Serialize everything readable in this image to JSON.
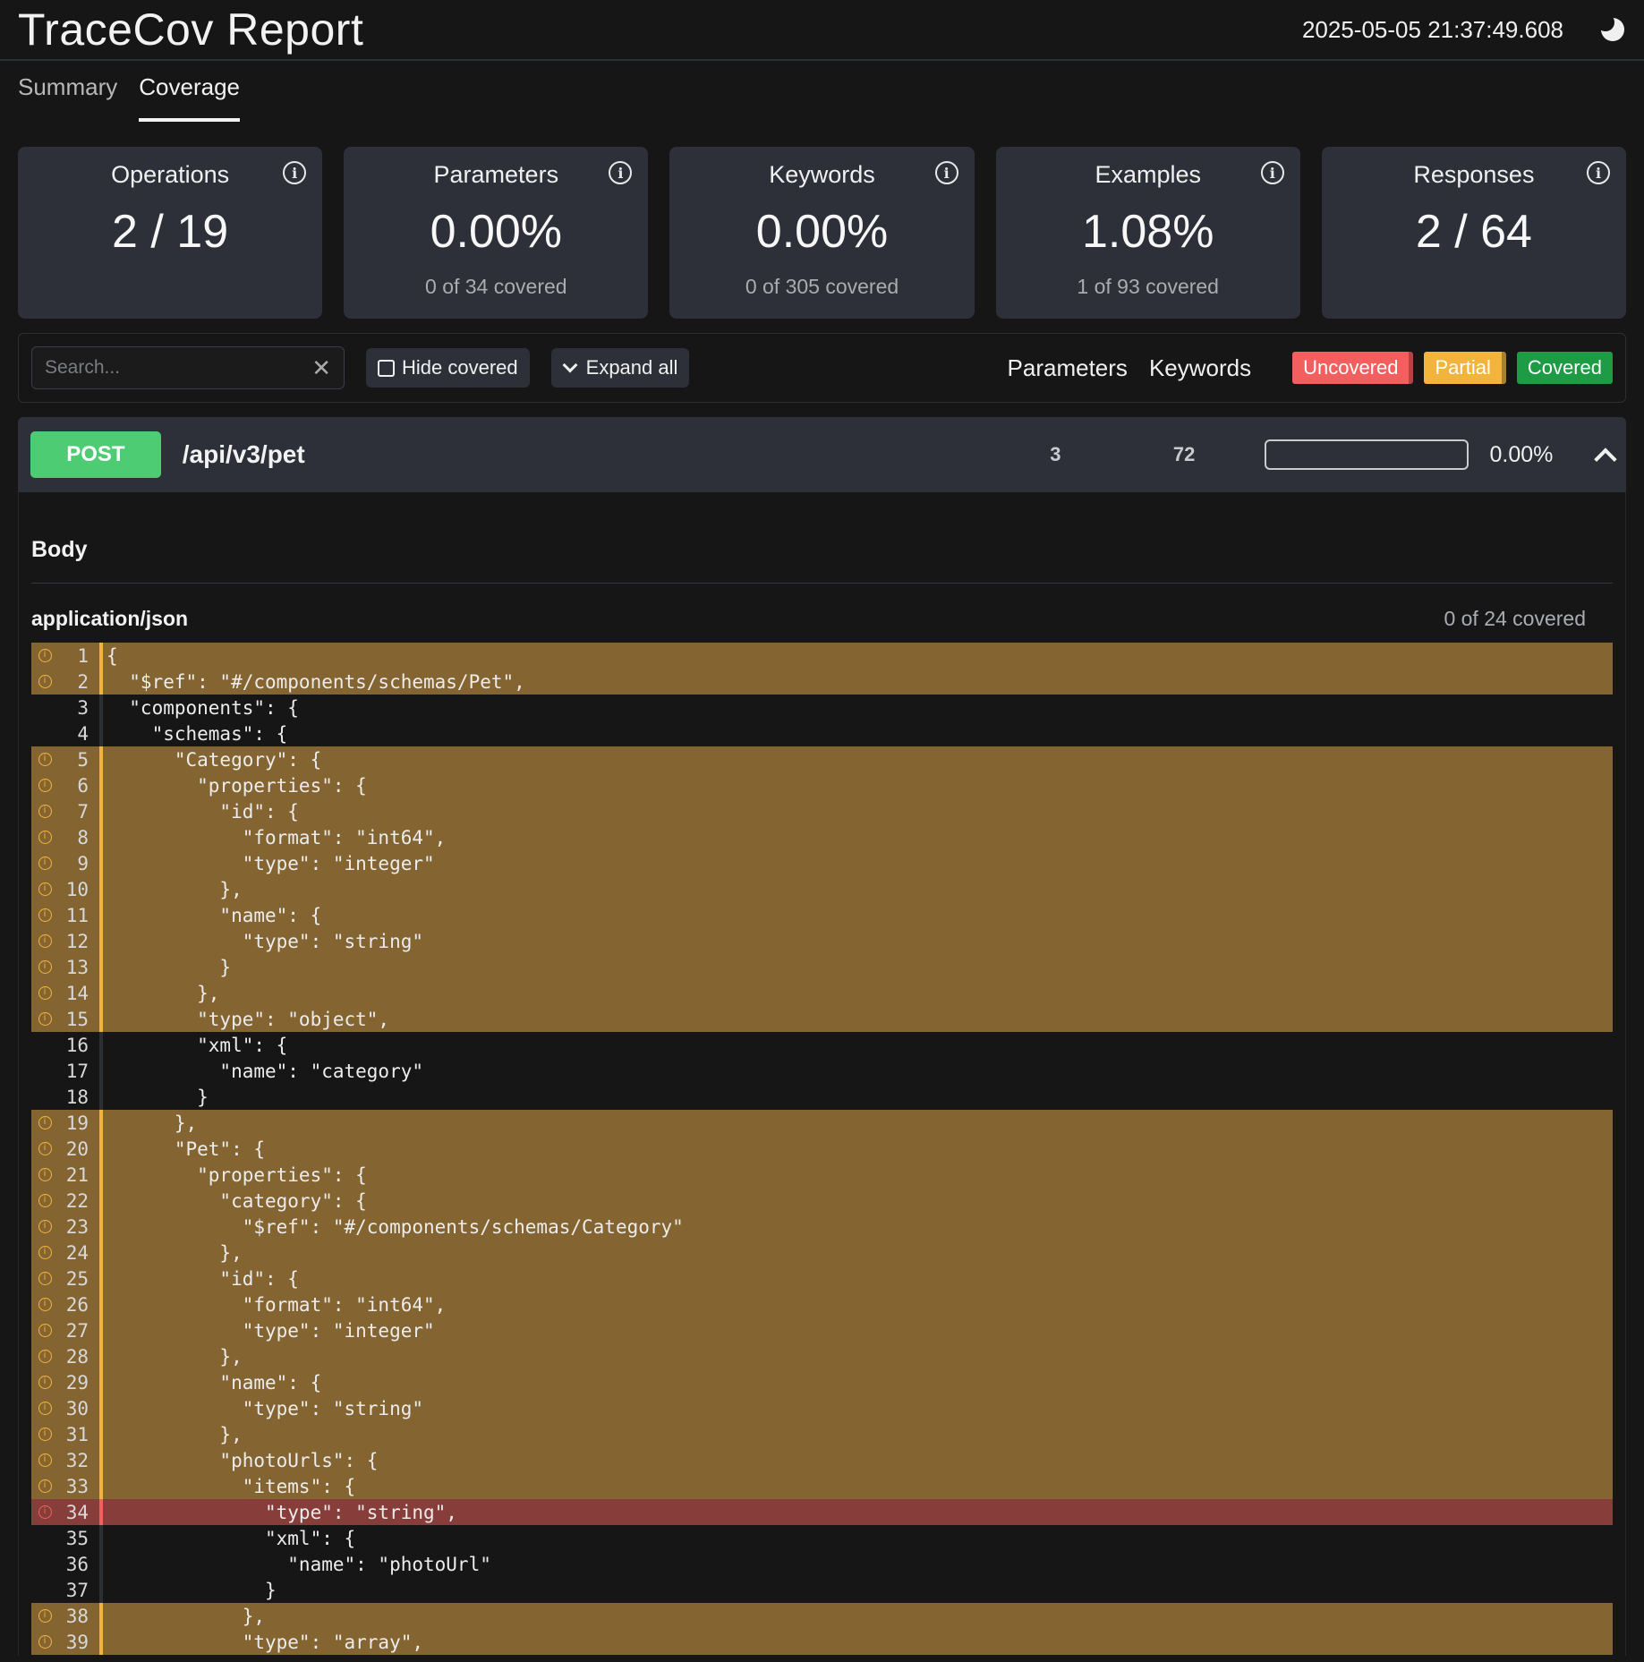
{
  "header": {
    "title": "TraceCov Report",
    "timestamp": "2025-05-05 21:37:49.608"
  },
  "tabs": [
    {
      "label": "Summary"
    },
    {
      "label": "Coverage"
    }
  ],
  "cards": [
    {
      "title": "Operations",
      "value": "2 / 19",
      "sub": ""
    },
    {
      "title": "Parameters",
      "value": "0.00%",
      "sub": "0 of 34 covered"
    },
    {
      "title": "Keywords",
      "value": "0.00%",
      "sub": "0 of 305 covered"
    },
    {
      "title": "Examples",
      "value": "1.08%",
      "sub": "1 of 93 covered"
    },
    {
      "title": "Responses",
      "value": "2 / 64",
      "sub": ""
    }
  ],
  "toolbar": {
    "search_placeholder": "Search...",
    "hide_covered": "Hide covered",
    "expand_all": "Expand all",
    "parameters_link": "Parameters",
    "keywords_link": "Keywords",
    "legend": {
      "uncovered": "Uncovered",
      "partial": "Partial",
      "covered": "Covered"
    }
  },
  "operation": {
    "method": "POST",
    "path": "/api/v3/pet",
    "count_a": "3",
    "count_b": "72",
    "progress": 0,
    "percent": "0.00%",
    "section": "Body",
    "content_type": "application/json",
    "covered_text": "0 of 24 covered",
    "lines": [
      {
        "n": "1",
        "text": "{",
        "s": "partial"
      },
      {
        "n": "2",
        "text": "  \"$ref\": \"#/components/schemas/Pet\",",
        "s": "partial"
      },
      {
        "n": "3",
        "text": "  \"components\": {",
        "s": ""
      },
      {
        "n": "4",
        "text": "    \"schemas\": {",
        "s": ""
      },
      {
        "n": "5",
        "text": "      \"Category\": {",
        "s": "partial"
      },
      {
        "n": "6",
        "text": "        \"properties\": {",
        "s": "partial"
      },
      {
        "n": "7",
        "text": "          \"id\": {",
        "s": "partial"
      },
      {
        "n": "8",
        "text": "            \"format\": \"int64\",",
        "s": "partial"
      },
      {
        "n": "9",
        "text": "            \"type\": \"integer\"",
        "s": "partial"
      },
      {
        "n": "10",
        "text": "          },",
        "s": "partial"
      },
      {
        "n": "11",
        "text": "          \"name\": {",
        "s": "partial"
      },
      {
        "n": "12",
        "text": "            \"type\": \"string\"",
        "s": "partial"
      },
      {
        "n": "13",
        "text": "          }",
        "s": "partial"
      },
      {
        "n": "14",
        "text": "        },",
        "s": "partial"
      },
      {
        "n": "15",
        "text": "        \"type\": \"object\",",
        "s": "partial"
      },
      {
        "n": "16",
        "text": "        \"xml\": {",
        "s": ""
      },
      {
        "n": "17",
        "text": "          \"name\": \"category\"",
        "s": ""
      },
      {
        "n": "18",
        "text": "        }",
        "s": ""
      },
      {
        "n": "19",
        "text": "      },",
        "s": "partial"
      },
      {
        "n": "20",
        "text": "      \"Pet\": {",
        "s": "partial"
      },
      {
        "n": "21",
        "text": "        \"properties\": {",
        "s": "partial"
      },
      {
        "n": "22",
        "text": "          \"category\": {",
        "s": "partial"
      },
      {
        "n": "23",
        "text": "            \"$ref\": \"#/components/schemas/Category\"",
        "s": "partial"
      },
      {
        "n": "24",
        "text": "          },",
        "s": "partial"
      },
      {
        "n": "25",
        "text": "          \"id\": {",
        "s": "partial"
      },
      {
        "n": "26",
        "text": "            \"format\": \"int64\",",
        "s": "partial"
      },
      {
        "n": "27",
        "text": "            \"type\": \"integer\"",
        "s": "partial"
      },
      {
        "n": "28",
        "text": "          },",
        "s": "partial"
      },
      {
        "n": "29",
        "text": "          \"name\": {",
        "s": "partial"
      },
      {
        "n": "30",
        "text": "            \"type\": \"string\"",
        "s": "partial"
      },
      {
        "n": "31",
        "text": "          },",
        "s": "partial"
      },
      {
        "n": "32",
        "text": "          \"photoUrls\": {",
        "s": "partial"
      },
      {
        "n": "33",
        "text": "            \"items\": {",
        "s": "partial"
      },
      {
        "n": "34",
        "text": "              \"type\": \"string\",",
        "s": "uncovered"
      },
      {
        "n": "35",
        "text": "              \"xml\": {",
        "s": ""
      },
      {
        "n": "36",
        "text": "                \"name\": \"photoUrl\"",
        "s": ""
      },
      {
        "n": "37",
        "text": "              }",
        "s": ""
      },
      {
        "n": "38",
        "text": "            },",
        "s": "partial"
      },
      {
        "n": "39",
        "text": "            \"type\": \"array\",",
        "s": "partial"
      }
    ]
  }
}
